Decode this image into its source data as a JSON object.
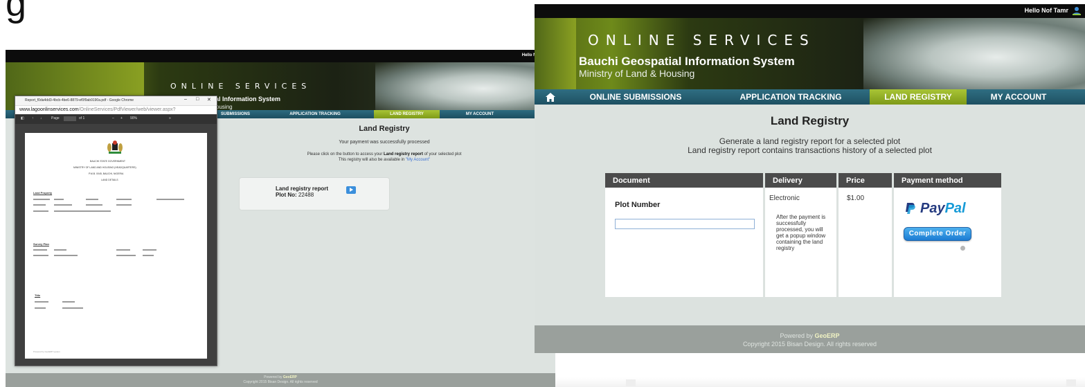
{
  "page": {
    "corner_glyph": "g"
  },
  "colors": {
    "nav_bg": "#1e5062",
    "nav_active": "#8fae22",
    "banner_dark": "#1c2214",
    "table_header": "#4b4b4b",
    "paypal_blue": "#253b80",
    "paypal_light": "#179bd7",
    "link": "#3a6fd2"
  },
  "left": {
    "greeting": "Hello Nof Tamr",
    "site": {
      "brand": "ONLINE SERVICES",
      "system": "Bauchi Geospatial Information System",
      "ministry": "Ministry of Land & Housing"
    },
    "nav": [
      "SUBMISSIONS",
      "APPLICATION TRACKING",
      "LAND REGISTRY",
      "MY ACCOUNT"
    ],
    "title": "Land Registry",
    "payment_msg": "Your payment was successfully processed",
    "instr_pre": "Please click on the button to access your ",
    "instr_bold": "Land registry report",
    "instr_post": " of your selected plot",
    "instr2_pre": "This registry will also be available in ",
    "instr2_link": "\"My Account\"",
    "report_label": "Land registry report",
    "plot_label": "Plot No:",
    "plot_no": "22488",
    "footer_powered": "Powered by",
    "footer_brand": "GeoERP",
    "footer_copy": "Copyright 2015 Bisan Design. All rights reserved"
  },
  "pdf": {
    "tab_title": "Report_f0da4dd3-4bcb-4be6-8879-ef0f9ab9190a.pdf - Google Chrome",
    "url_domain": "www.lagoonlinservices.com",
    "url_path": "/OnlineServices/PdfViewer/web/viewer.aspx?",
    "toolbar_page": "Page",
    "toolbar_of": "of 1",
    "toolbar_zoom": "90%",
    "doc_line1": "BAUCHI STATE GOVERNMENT",
    "doc_line2": "MINISTRY OF LAND AND HOUSING (HEADQUARTERS)",
    "doc_line3": "P.M.B. 0045, BAUCHI, NIGERIA",
    "doc_line4": "LAND DETAILS",
    "sec1": "Land Property",
    "sec2": "Survey Plan",
    "sec3": "Title",
    "footer_note": "Powered by GeoERP system"
  },
  "right": {
    "greeting": "Hello Nof Tamr",
    "site": {
      "brand": "ONLINE SERVICES",
      "system": "Bauchi Geospatial Information System",
      "ministry": "Ministry of Land & Housing"
    },
    "nav": [
      "ONLINE SUBMISSIONS",
      "APPLICATION TRACKING",
      "LAND REGISTRY",
      "MY ACCOUNT"
    ],
    "title": "Land Registry",
    "subtitle1": "Generate a land registry report for a selected plot",
    "subtitle2": "Land registry report contains transactions history of a selected plot",
    "table": {
      "headers": [
        "Document",
        "Delivery",
        "Price",
        "Payment method"
      ],
      "plot_label": "Plot Number",
      "plot_value": "",
      "delivery": "Electronic",
      "delivery_note": "After the payment is successfully processed, you will get a popup window containing the land registry",
      "price": "$1.00",
      "paypal_a": "Pay",
      "paypal_b": "Pal",
      "complete_btn": "Complete Order"
    },
    "footer_powered": "Powered by",
    "footer_brand": "GeoERP",
    "footer_copy": "Copyright 2015 Bisan Design. All rights reserved"
  }
}
